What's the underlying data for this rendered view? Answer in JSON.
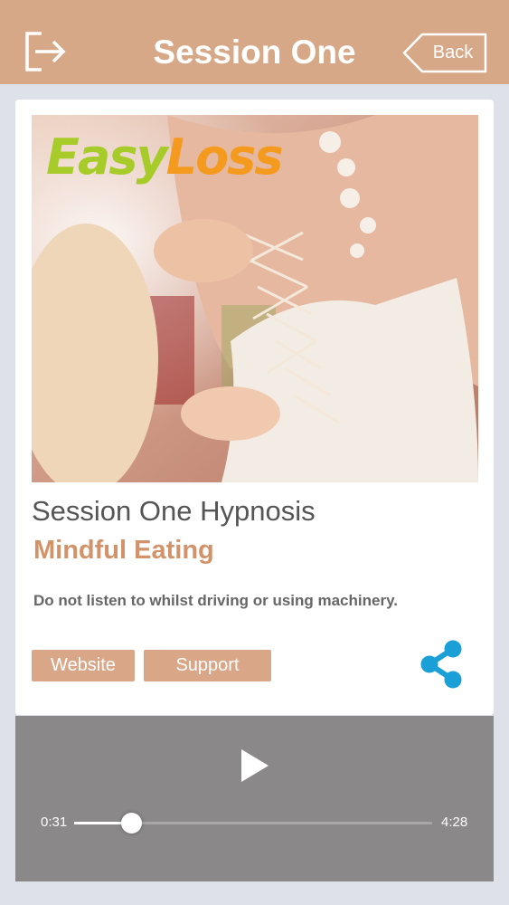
{
  "header": {
    "title": "Session One",
    "back_label": "Back",
    "logout_icon": "logout-icon"
  },
  "colors": {
    "brand": "#d7a887",
    "accent": "#d3936a",
    "share": "#1a9fd6",
    "player_bg": "#8a8889"
  },
  "content": {
    "logo_text": "EasyLoss",
    "session_name": "Session One Hypnosis",
    "subtitle": "Mindful Eating",
    "warning": "Do not listen to whilst driving or using machinery.",
    "buttons": {
      "website": "Website",
      "support": "Support"
    },
    "share_icon": "share-icon"
  },
  "player": {
    "current_time": "0:31",
    "total_time": "4:28",
    "progress": 0.16,
    "play_icon": "play-icon"
  }
}
